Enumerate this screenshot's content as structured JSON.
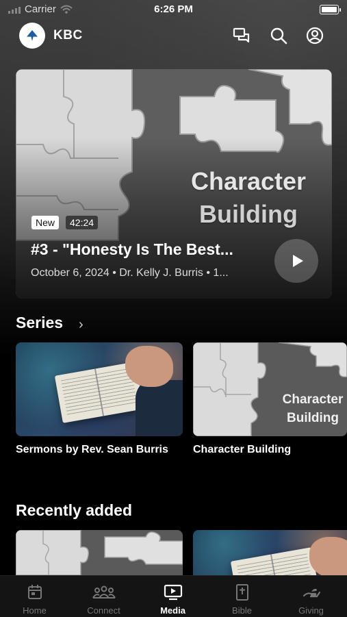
{
  "status_bar": {
    "carrier": "Carrier",
    "time": "6:26 PM"
  },
  "header": {
    "brand": "KBC",
    "logo_text": ""
  },
  "hero": {
    "badge_new": "New",
    "duration": "42:24",
    "art_line1": "Character",
    "art_line2": "Building",
    "title": "#3 - \"Honesty Is The Best...",
    "meta": "October 6, 2024 • Dr. Kelly J. Burris • 1..."
  },
  "series": {
    "title": "Series",
    "items": [
      {
        "label": "Sermons by Rev. Sean Burris"
      },
      {
        "label": "Character Building",
        "art_line1": "Character",
        "art_line2": "Building"
      }
    ]
  },
  "recent": {
    "title": "Recently added"
  },
  "tabs": [
    {
      "label": "Home",
      "icon": "calendar-icon"
    },
    {
      "label": "Connect",
      "icon": "people-icon"
    },
    {
      "label": "Media",
      "icon": "tv-play-icon"
    },
    {
      "label": "Bible",
      "icon": "bible-icon"
    },
    {
      "label": "Giving",
      "icon": "giving-hand-icon"
    }
  ],
  "colors": {
    "background": "#000000",
    "active_tab": "#ffffff",
    "inactive_tab": "#777777"
  }
}
